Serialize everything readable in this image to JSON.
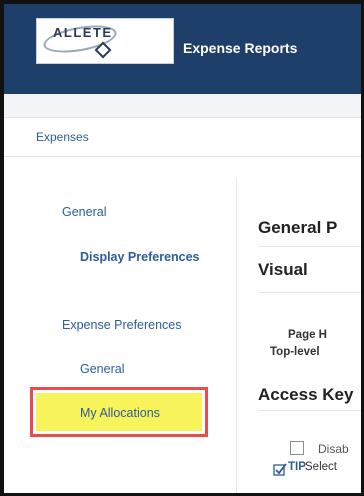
{
  "header": {
    "logo_text": "ALLETE",
    "app_title": "Expense Reports"
  },
  "breadcrumb": {
    "current": "Expenses"
  },
  "sidebar": {
    "items": [
      {
        "label": "General"
      },
      {
        "label": "Display Preferences"
      },
      {
        "label": "Expense Preferences"
      },
      {
        "label": "General"
      },
      {
        "label": "My Allocations"
      }
    ]
  },
  "main": {
    "section_general": "General P",
    "section_visual": "Visual",
    "field_page": "Page H",
    "field_toplevel": "Top-level",
    "section_access": "Access Key",
    "checkbox_label": "Disab",
    "tip_label": "TIP",
    "tip_text": "Select"
  },
  "colors": {
    "header_bg": "#1f3f6b",
    "link": "#2d5c9a",
    "highlight_fill": "#f6f45a",
    "highlight_border": "#ea4b4b"
  },
  "icons": {
    "tip": "tip-check-icon",
    "logo": "allete-logo-icon"
  }
}
